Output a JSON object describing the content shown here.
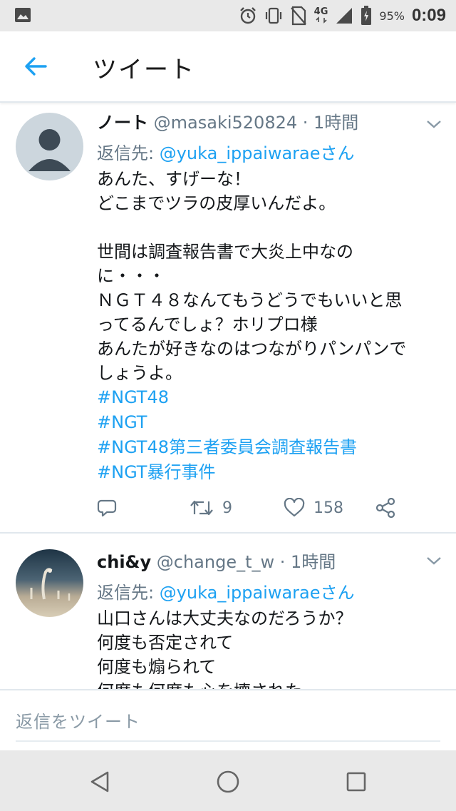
{
  "status_bar": {
    "battery_percent": "95%",
    "network": "4G",
    "time": "0:09",
    "icons": [
      "image-icon",
      "alarm-icon",
      "vibrate-icon",
      "no-sim-icon",
      "signal-icon",
      "battery-icon"
    ]
  },
  "app_bar": {
    "title": "ツイート",
    "back_icon": "arrow-left-icon"
  },
  "tweets": [
    {
      "name": "ノート",
      "handle": "@masaki520824",
      "time": "· 1時間",
      "reply_label": "返信先: ",
      "reply_mention": "@yuka_ippaiwaraeさん",
      "text": "あんた、すげーな！\nどこまでツラの皮厚いんだよ。\n\n世間は調査報告書で大炎上中なの\nに・・・\nＮＧＴ４８なんてもうどうでもいいと思\nってるんでしょ？ホリプロ様\nあんたが好きなのはつながりパンパンで\nしょうよ。",
      "hashtags": [
        "#NGT48",
        "#NGT",
        "#NGT48第三者委員会調査報告書",
        "#NGT暴行事件"
      ],
      "actions": {
        "retweets": "9",
        "likes": "158"
      }
    },
    {
      "name": "chi&y",
      "handle": "@change_t_w",
      "time": "· 1時間",
      "reply_label": "返信先: ",
      "reply_mention": "@yuka_ippaiwaraeさん",
      "text": "山口さんは大丈夫なのだろうか？\n何度も否定されて\n何度も煽られて\n何度も何度も心を壊された"
    }
  ],
  "composer": {
    "placeholder": "返信をツイート"
  },
  "colors": {
    "accent": "#1da1f2",
    "secondary_text": "#657786",
    "divider": "#e1e8ed"
  }
}
